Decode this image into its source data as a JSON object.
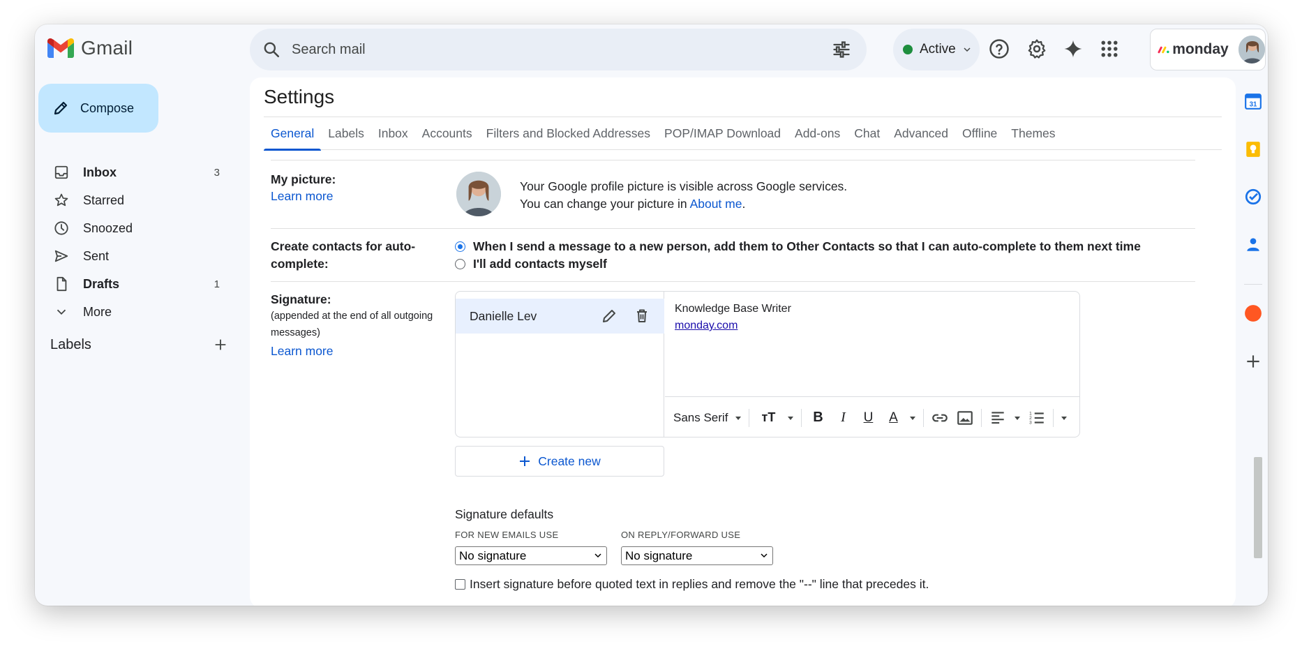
{
  "app": {
    "name": "Gmail"
  },
  "search": {
    "placeholder": "Search mail"
  },
  "status": {
    "label": "Active",
    "color": "#1e8e3e"
  },
  "brand_badge": {
    "name": "monday"
  },
  "sidebar": {
    "compose_label": "Compose",
    "items": [
      {
        "label": "Inbox",
        "count": "3",
        "icon": "inbox-icon",
        "bold": true
      },
      {
        "label": "Starred",
        "count": "",
        "icon": "star-icon",
        "bold": false
      },
      {
        "label": "Snoozed",
        "count": "",
        "icon": "clock-icon",
        "bold": false
      },
      {
        "label": "Sent",
        "count": "",
        "icon": "send-icon",
        "bold": false
      },
      {
        "label": "Drafts",
        "count": "1",
        "icon": "draft-icon",
        "bold": true
      },
      {
        "label": "More",
        "count": "",
        "icon": "chevron-down-icon",
        "bold": false
      }
    ],
    "labels_heading": "Labels"
  },
  "settings": {
    "title": "Settings",
    "tabs": [
      "General",
      "Labels",
      "Inbox",
      "Accounts",
      "Filters and Blocked Addresses",
      "POP/IMAP Download",
      "Add-ons",
      "Chat",
      "Advanced",
      "Offline",
      "Themes"
    ],
    "selected_tab": "General",
    "my_picture": {
      "label": "My picture:",
      "learn_more": "Learn more",
      "line1": "Your Google profile picture is visible across Google services.",
      "line2_prefix": "You can change your picture in ",
      "line2_link": "About me",
      "line2_suffix": "."
    },
    "auto_contacts": {
      "label_line1": "Create contacts for auto-",
      "label_line2": "complete:",
      "option1": "When I send a message to a new person, add them to Other Contacts so that I can auto-complete to them next time",
      "option2": "I'll add contacts myself",
      "selected": "option1"
    },
    "signature": {
      "label": "Signature:",
      "desc_line1": "(appended at the end of all outgoing",
      "desc_line2": "messages)",
      "learn_more": "Learn more",
      "entries": [
        {
          "name": "Danielle Lev"
        }
      ],
      "body_line1": "Knowledge Base Writer",
      "body_link": "monday.com",
      "font_select": "Sans Serif",
      "create_new": "Create new",
      "defaults_title": "Signature defaults",
      "new_emails_label": "FOR NEW EMAILS USE",
      "new_emails_value": "No signature",
      "reply_label": "ON REPLY/FORWARD USE",
      "reply_value": "No signature",
      "insert_before_quoted": "Insert signature before quoted text in replies and remove the \"--\" line that precedes it."
    }
  },
  "colors": {
    "accent": "#0b57d0",
    "compose_bg": "#c2e7ff",
    "selected_row": "#e8f0fe"
  }
}
